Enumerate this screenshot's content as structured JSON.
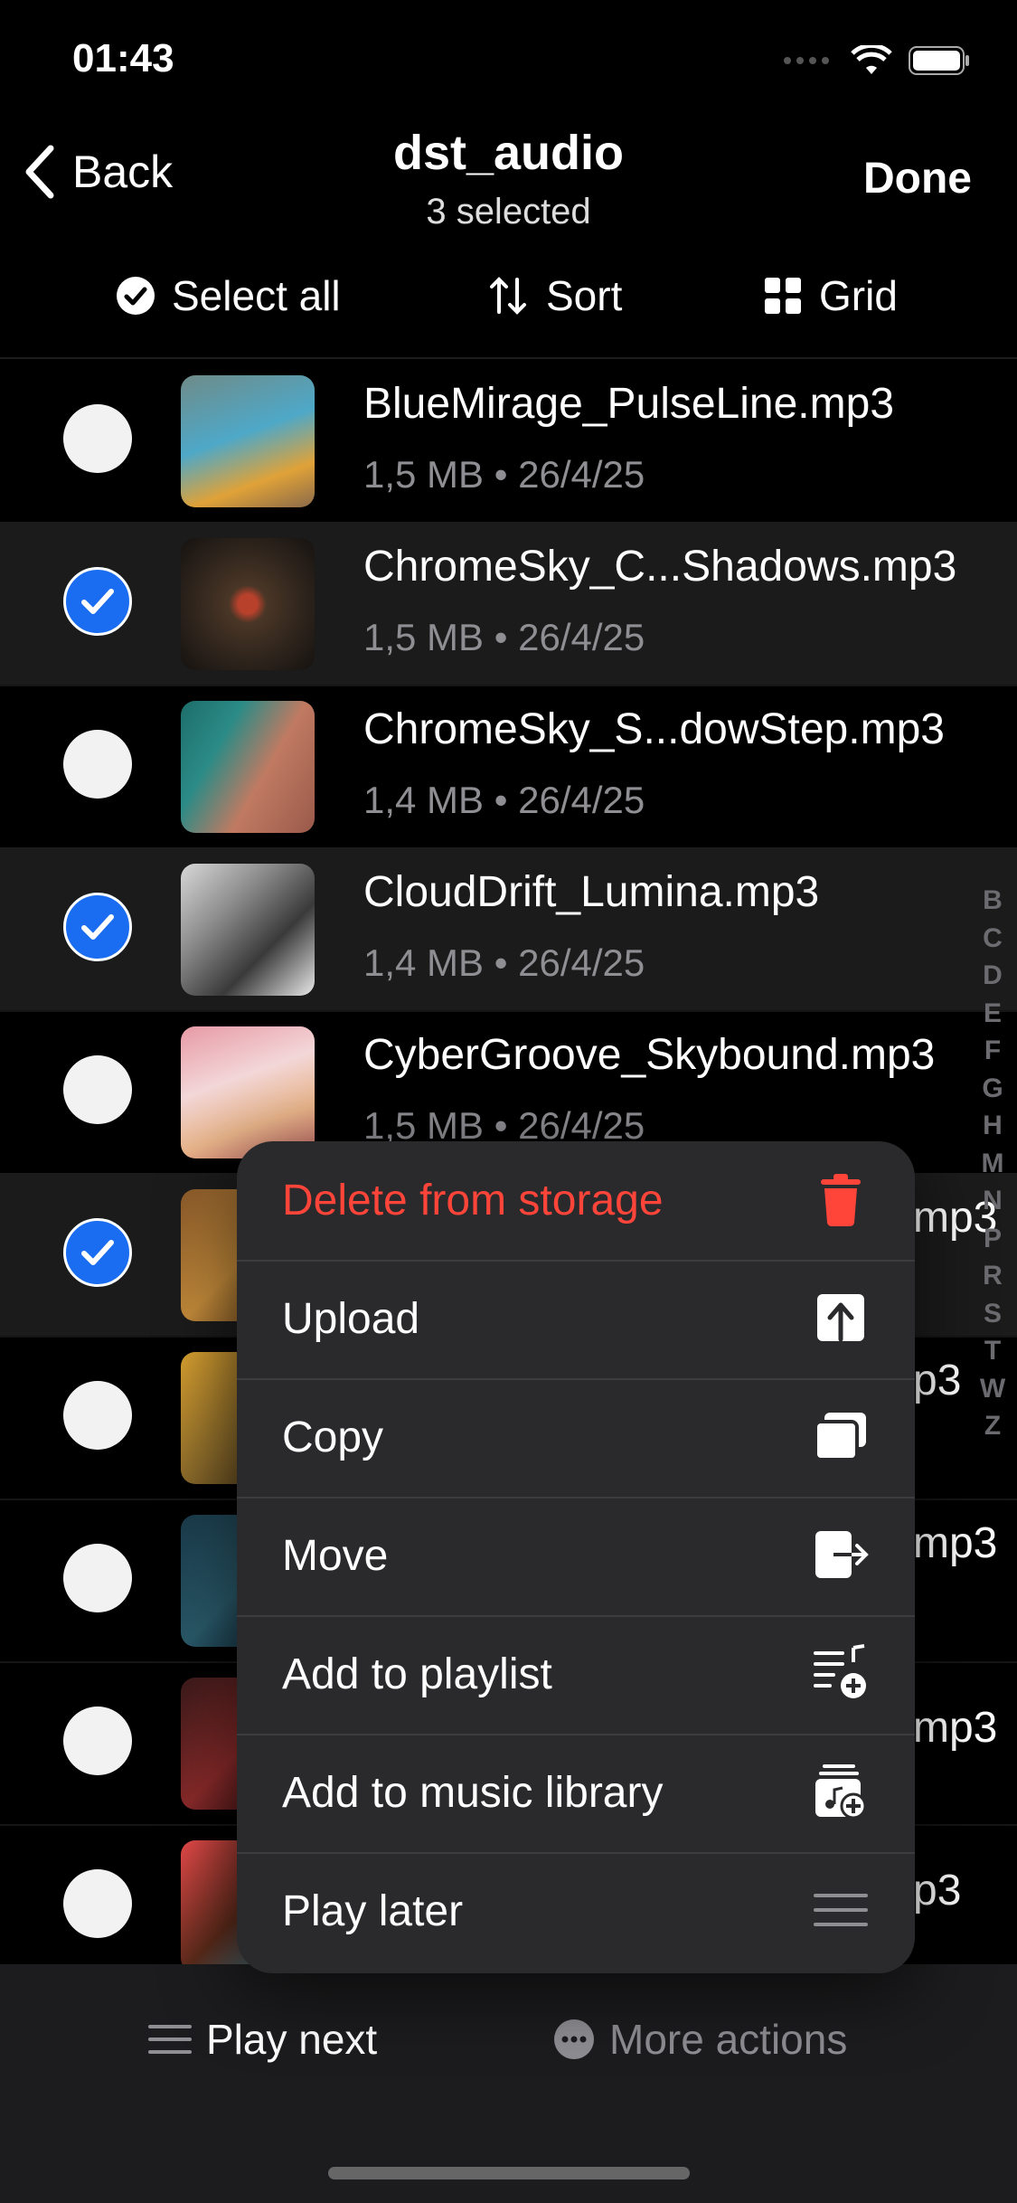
{
  "status": {
    "time": "01:43"
  },
  "nav": {
    "back_label": "Back",
    "title": "dst_audio",
    "subtitle": "3 selected",
    "done_label": "Done"
  },
  "toolbar": {
    "select_all": "Select all",
    "sort": "Sort",
    "grid": "Grid"
  },
  "rows": [
    {
      "title": "BlueMirage_PulseLine.mp3",
      "meta": "1,5 MB • 26/4/25",
      "selected": false
    },
    {
      "title": "ChromeSky_C...Shadows.mp3",
      "meta": "1,5 MB • 26/4/25",
      "selected": true
    },
    {
      "title": "ChromeSky_S...dowStep.mp3",
      "meta": "1,4 MB • 26/4/25",
      "selected": false
    },
    {
      "title": "CloudDrift_Lumina.mp3",
      "meta": "1,4 MB • 26/4/25",
      "selected": true
    },
    {
      "title": "CyberGroove_Skybound.mp3",
      "meta": "1,5 MB • 26/4/25",
      "selected": false
    },
    {
      "tail": "mp3",
      "selected": true
    },
    {
      "tail": "p3",
      "selected": false
    },
    {
      "tail": "mp3",
      "selected": false
    },
    {
      "tail": "mp3",
      "selected": false
    },
    {
      "tail": "p3",
      "selected": false
    }
  ],
  "index_letters": [
    "B",
    "C",
    "D",
    "E",
    "F",
    "G",
    "H",
    "M",
    "N",
    "P",
    "R",
    "S",
    "T",
    "W",
    "Z"
  ],
  "menu": {
    "delete": "Delete from storage",
    "upload": "Upload",
    "copy": "Copy",
    "move": "Move",
    "add_playlist": "Add to playlist",
    "add_library": "Add to music library",
    "play_later": "Play later"
  },
  "bottom": {
    "play_next": "Play next",
    "more_actions": "More actions"
  },
  "colors": {
    "accent": "#1a6cf0",
    "destructive": "#ff453a",
    "background": "#000000",
    "menu_bg": "#2a2a2c"
  }
}
